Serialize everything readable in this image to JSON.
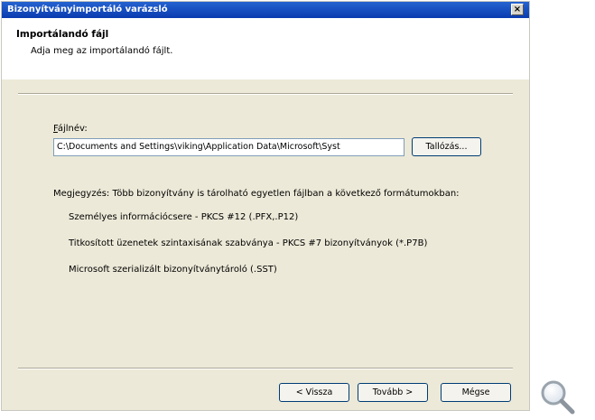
{
  "window": {
    "title": "Bizonyítványimportáló varázsló",
    "close_glyph": "×"
  },
  "header": {
    "title": "Importálandó fájl",
    "subtitle": "Adja meg az importálandó fájlt."
  },
  "file": {
    "label_mnemonic": "F",
    "label_rest": "ájlnév:",
    "path_value": "C:\\Documents and Settings\\viking\\Application Data\\Microsoft\\Syst",
    "browse_label": "Tallózás..."
  },
  "notes": {
    "intro": "Megjegyzés: Több bizonyítvány is tárolható egyetlen fájlban a következő formátumokban:",
    "formats": [
      "Személyes információcsere - PKCS #12 (.PFX,.P12)",
      "Titkosított üzenetek szintaxisának szabványa - PKCS #7 bizonyítványok (*.P7B)",
      "Microsoft szerializált bizonyítványtároló (.SST)"
    ]
  },
  "footer": {
    "back_label": "< Vissza",
    "next_label": "Tovább >",
    "cancel_label": "Mégse"
  },
  "icons": {
    "zoom": "magnifier-icon"
  }
}
